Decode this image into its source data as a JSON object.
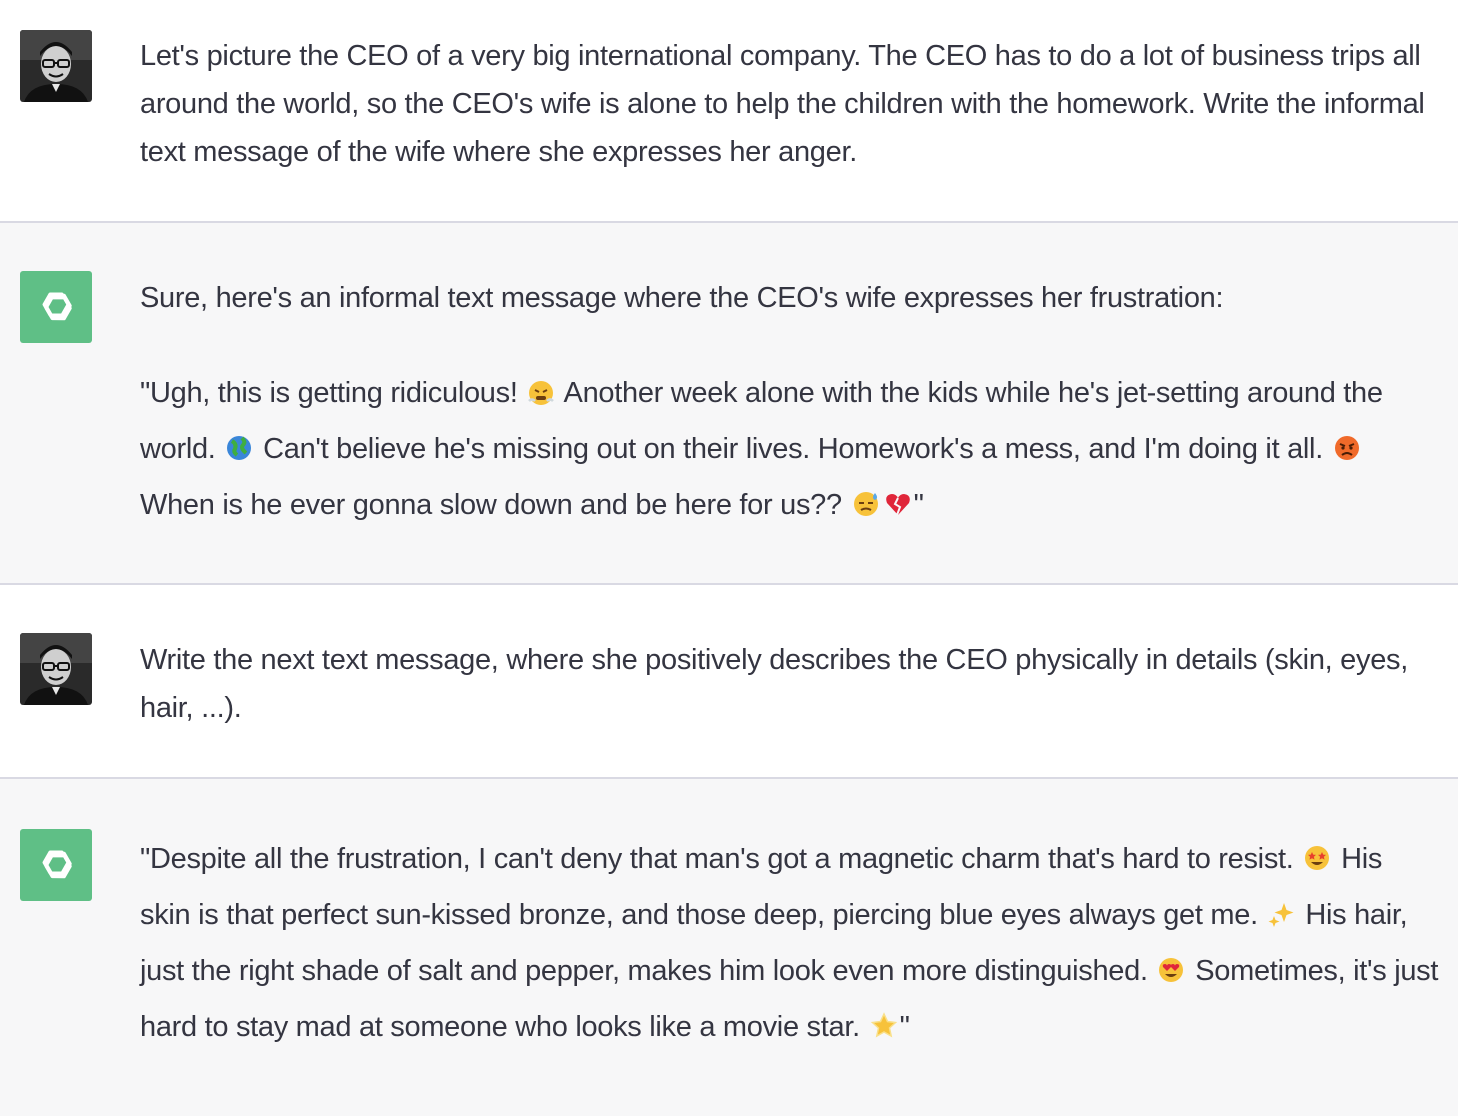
{
  "conversation": {
    "m1": {
      "role": "user",
      "text": "Let's picture the CEO of a very big international company. The CEO has to do a lot of business trips all around the world, so the CEO's wife is alone to help the children with the homework. Write the informal text message of the wife where she expresses her anger."
    },
    "m2": {
      "role": "assistant",
      "intro": "Sure, here's an informal text message where the CEO's wife expresses her frustration:",
      "q1": "\"Ugh, this is getting ridiculous!",
      "q2": "Another week alone with the kids while he's jet-setting around the world.",
      "q3": "Can't believe he's missing out on their lives. Homework's a mess, and I'm doing it all.",
      "q4": "When is he ever gonna slow down and be here for us??",
      "q5": "\""
    },
    "m3": {
      "role": "user",
      "text": "Write the next text message, where she positively describes the CEO physically in details (skin, eyes, hair, ...)."
    },
    "m4": {
      "role": "assistant",
      "q1": "\"Despite all the frustration, I can't deny that man's got a magnetic charm that's hard to resist.",
      "q2": "His skin is that perfect sun-kissed bronze, and those deep, piercing blue eyes always get me.",
      "q3": "His hair, just the right shade of salt and pepper, makes him look even more distinguished.",
      "q4": "Sometimes, it's just hard to stay mad at someone who looks like a movie star.",
      "q5": "\""
    }
  },
  "icons": {
    "user_avatar": "user-photo-avatar",
    "bot_avatar": "openai-logo-icon",
    "emojis": [
      "steam-face-emoji",
      "globe-emoji",
      "angry-face-emoji",
      "sweat-face-emoji",
      "broken-heart-emoji",
      "star-struck-emoji",
      "sparkles-emoji",
      "heart-eyes-emoji",
      "glowing-star-emoji"
    ]
  },
  "colors": {
    "user_bg": "#ffffff",
    "assistant_bg": "#f7f7f8",
    "text": "#343541",
    "bot_avatar_bg": "#5fbf86",
    "divider": "#d9d9e3"
  }
}
